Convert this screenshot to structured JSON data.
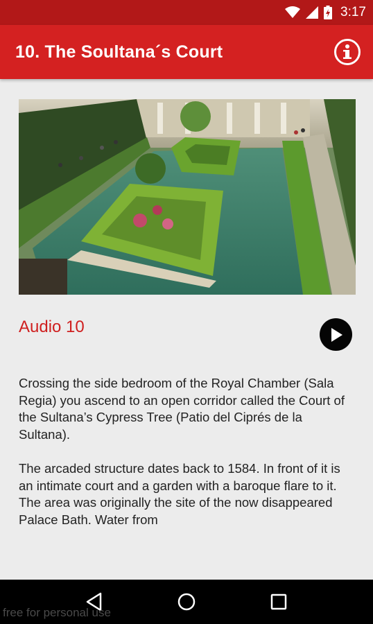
{
  "status_bar": {
    "time": "3:17",
    "icons": [
      "wifi-icon",
      "signal-icon",
      "battery-icon"
    ]
  },
  "app_bar": {
    "title": "10. The Soultana´s Court",
    "info_icon": "info-icon",
    "background": "#d42121"
  },
  "hero": {
    "image_icon": "garden-photo"
  },
  "audio": {
    "label": "Audio 10",
    "play_icon": "play-icon"
  },
  "content": {
    "paragraphs": [
      "Crossing the side bedroom of the Royal Chamber (Sala Regia) you ascend to an open corridor called the Court of the Sultana’s Cypress Tree (Patio del Ciprés de la Sultana).",
      "The arcaded structure dates back to 1584. In front of it is an intimate court and a garden with a baroque flare to it. The area was originally the site of the now disappeared Palace Bath. Water from"
    ]
  },
  "nav": {
    "back_icon": "back-icon",
    "home_icon": "home-icon",
    "recents_icon": "recents-icon"
  },
  "watermark": {
    "text": "free for personal use"
  },
  "colors": {
    "accent": "#d42121",
    "status_bar": "#b21818",
    "background": "#ececec",
    "audio_label": "#cf1f1f"
  }
}
